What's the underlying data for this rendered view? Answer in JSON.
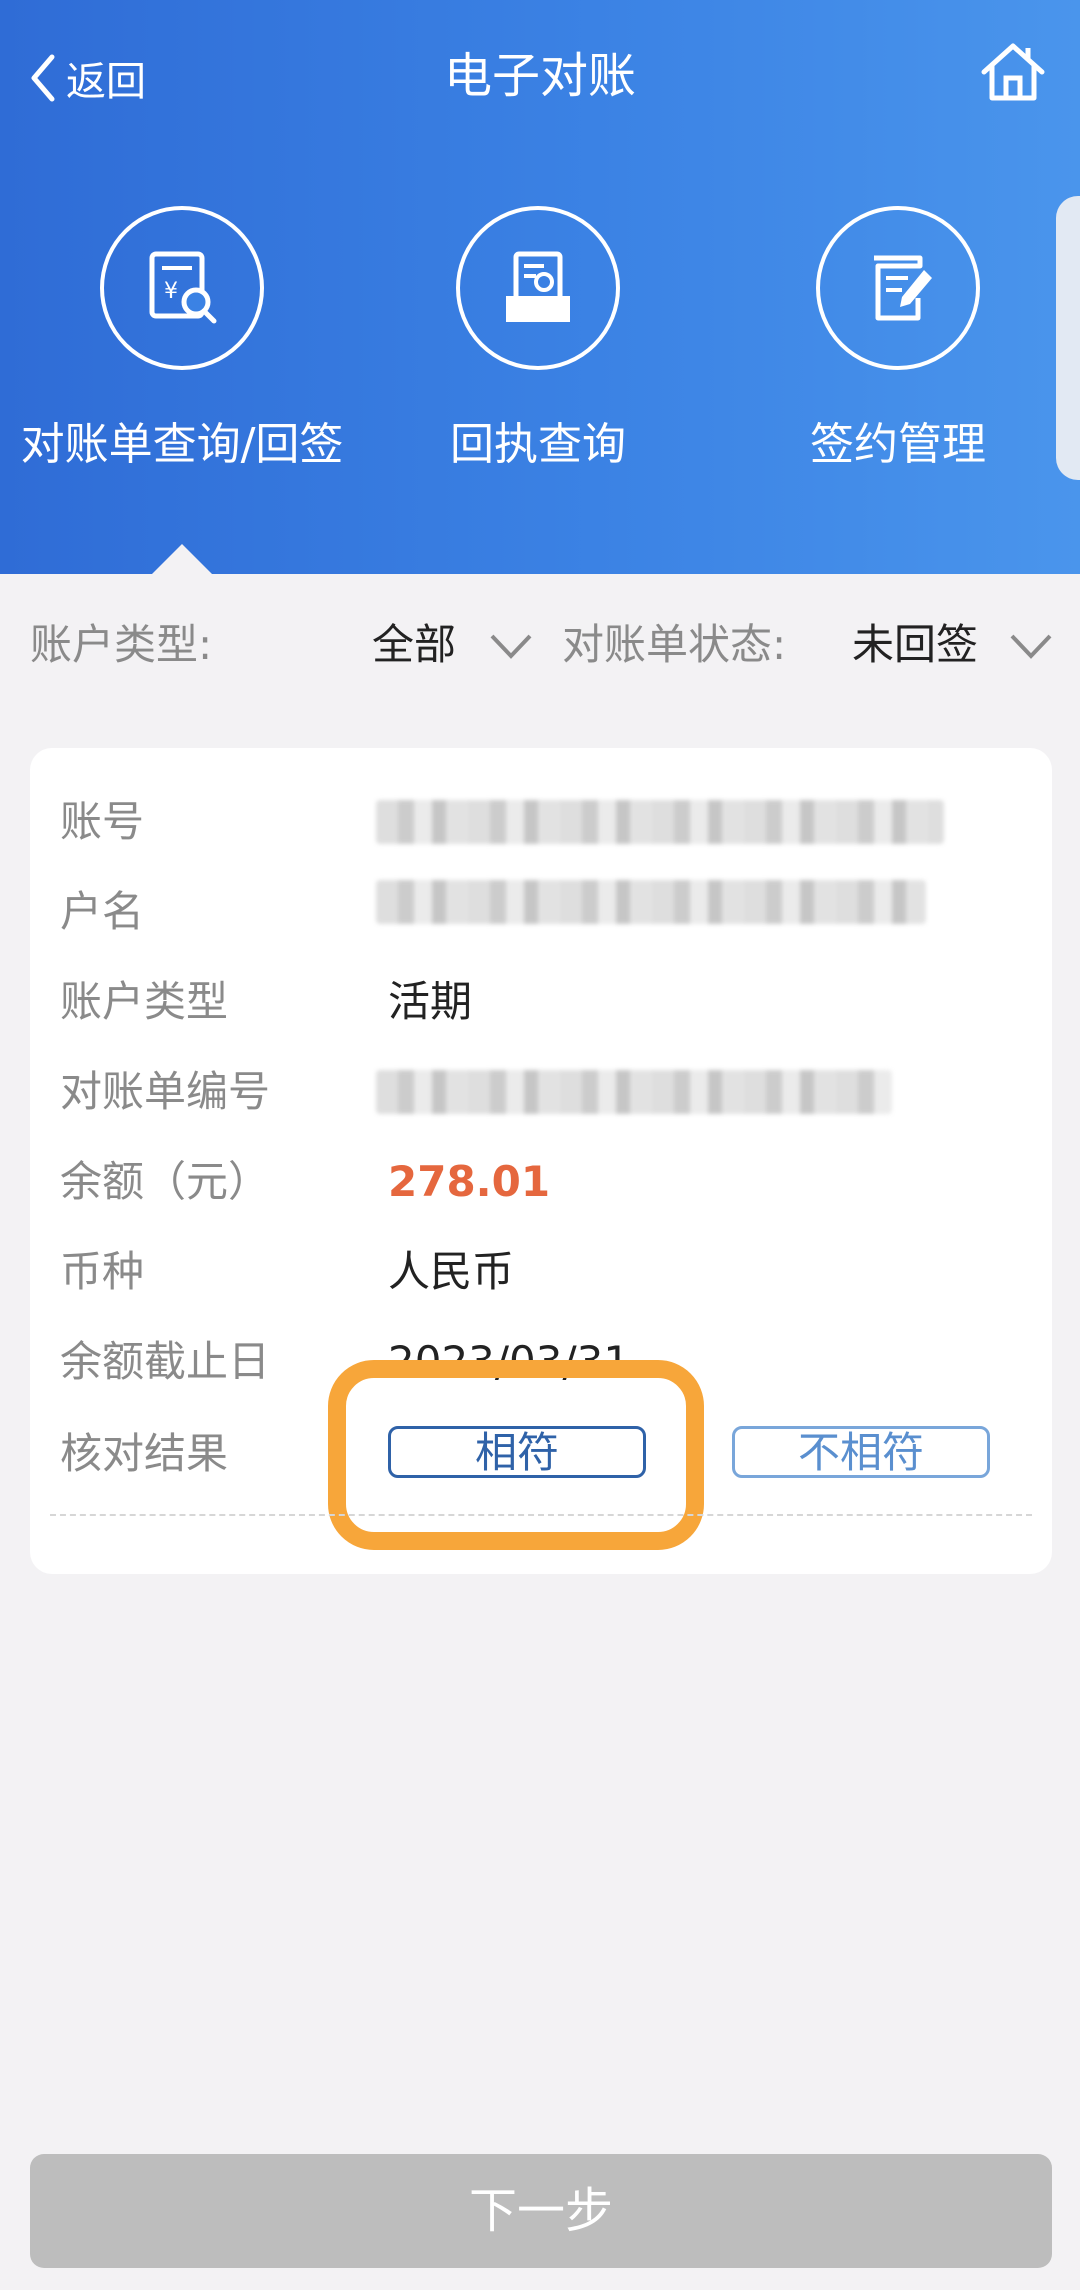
{
  "header": {
    "back_label": "返回",
    "title": "电子对账",
    "bg_colors": [
      "#2f6cd6",
      "#4a95ec"
    ]
  },
  "nav": [
    {
      "label": "对账单查询/回签",
      "icon": "statement-search-icon",
      "selected": true
    },
    {
      "label": "回执查询",
      "icon": "receipt-search-icon",
      "selected": false
    },
    {
      "label": "签约管理",
      "icon": "contract-edit-icon",
      "selected": false
    }
  ],
  "filters": {
    "account_type_label": "账户类型:",
    "account_type_value": "全部",
    "status_label": "对账单状态:",
    "status_value": "未回签"
  },
  "card": {
    "rows": [
      {
        "label": "账号",
        "value": null
      },
      {
        "label": "户名",
        "value": null
      },
      {
        "label": "账户类型",
        "value": "活期"
      },
      {
        "label": "对账单编号",
        "value": null
      },
      {
        "label": "余额（元）",
        "value": "278.01"
      },
      {
        "label": "币种",
        "value": "人民币"
      },
      {
        "label": "余额截止日",
        "value": "2023/03/31"
      },
      {
        "label": "核对结果",
        "value": null
      }
    ],
    "match_label": "相符",
    "nomatch_label": "不相符"
  },
  "next_label": "下一步",
  "colors": {
    "accent": "#2f62a8",
    "balance": "#e5673e",
    "highlight": "#f7a63a",
    "disabled_button": "#bdbdbd"
  }
}
